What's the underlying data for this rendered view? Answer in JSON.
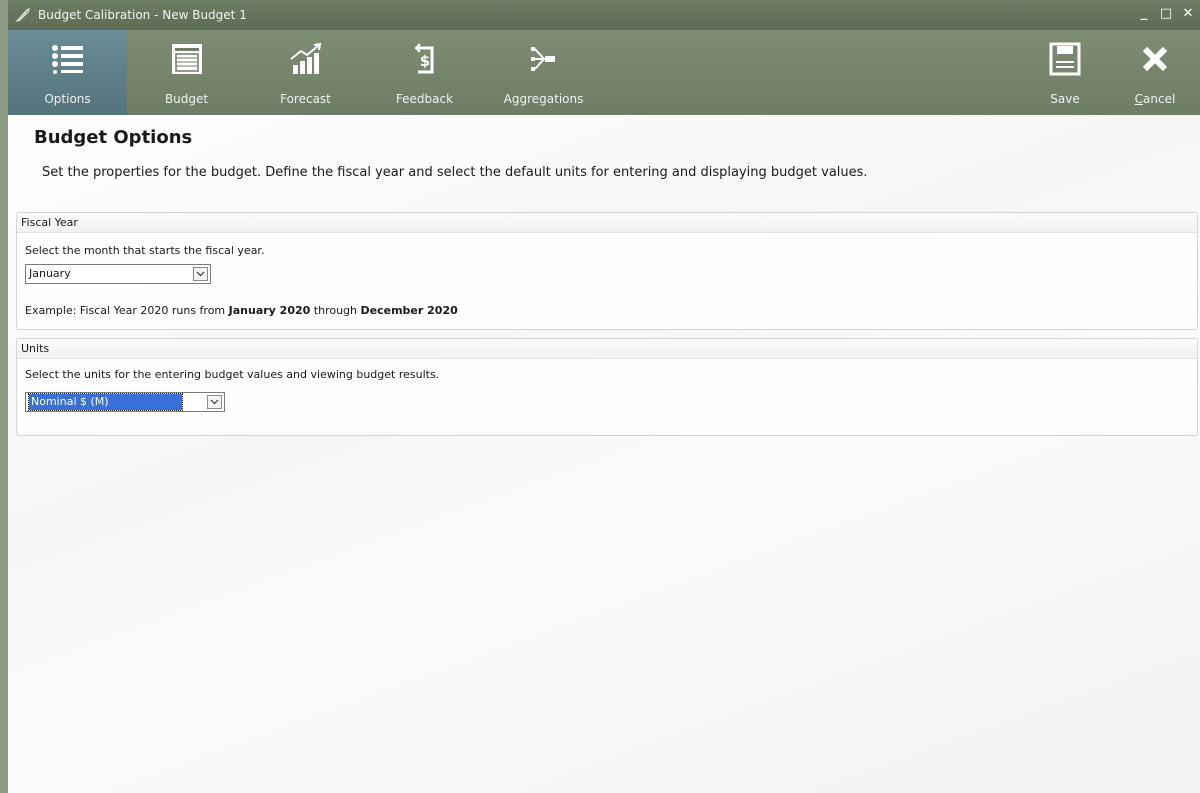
{
  "window": {
    "title": "Budget Calibration - New Budget 1",
    "controls": {
      "minimize": "_",
      "maximize": "□",
      "close": "✕"
    }
  },
  "toolbar": {
    "items": [
      {
        "label": "Options",
        "icon": "list-icon",
        "active": true
      },
      {
        "label": "Budget",
        "icon": "ledger-icon",
        "active": false
      },
      {
        "label": "Forecast",
        "icon": "chart-trend-icon",
        "active": false
      },
      {
        "label": "Feedback",
        "icon": "dollar-feedback-icon",
        "active": false
      },
      {
        "label": "Aggregations",
        "icon": "merge-arrow-icon",
        "active": false
      }
    ],
    "save_label": "Save",
    "cancel_label": "Cancel",
    "cancel_mnemonic": "C"
  },
  "page": {
    "title": "Budget Options",
    "description": "Set the properties for the budget. Define the fiscal year and select the default units for entering and displaying budget values."
  },
  "fiscal_year": {
    "header": "Fiscal Year",
    "instruction": "Select the month that starts the fiscal year.",
    "selected_month": "January",
    "example_prefix": "Example: Fiscal Year 2020 runs from ",
    "example_start": "January 2020",
    "example_mid": " through ",
    "example_end": "December 2020"
  },
  "units": {
    "header": "Units",
    "instruction": "Select the units for the entering budget values and viewing budget results.",
    "selected_unit": "Nominal $ (M)"
  },
  "colors": {
    "toolbar_bg": "#7d8c73",
    "titlebar_bg": "#6d7d64",
    "active_tab_bg": "#5d7f8a",
    "selection_bg": "#3a6fd8"
  }
}
